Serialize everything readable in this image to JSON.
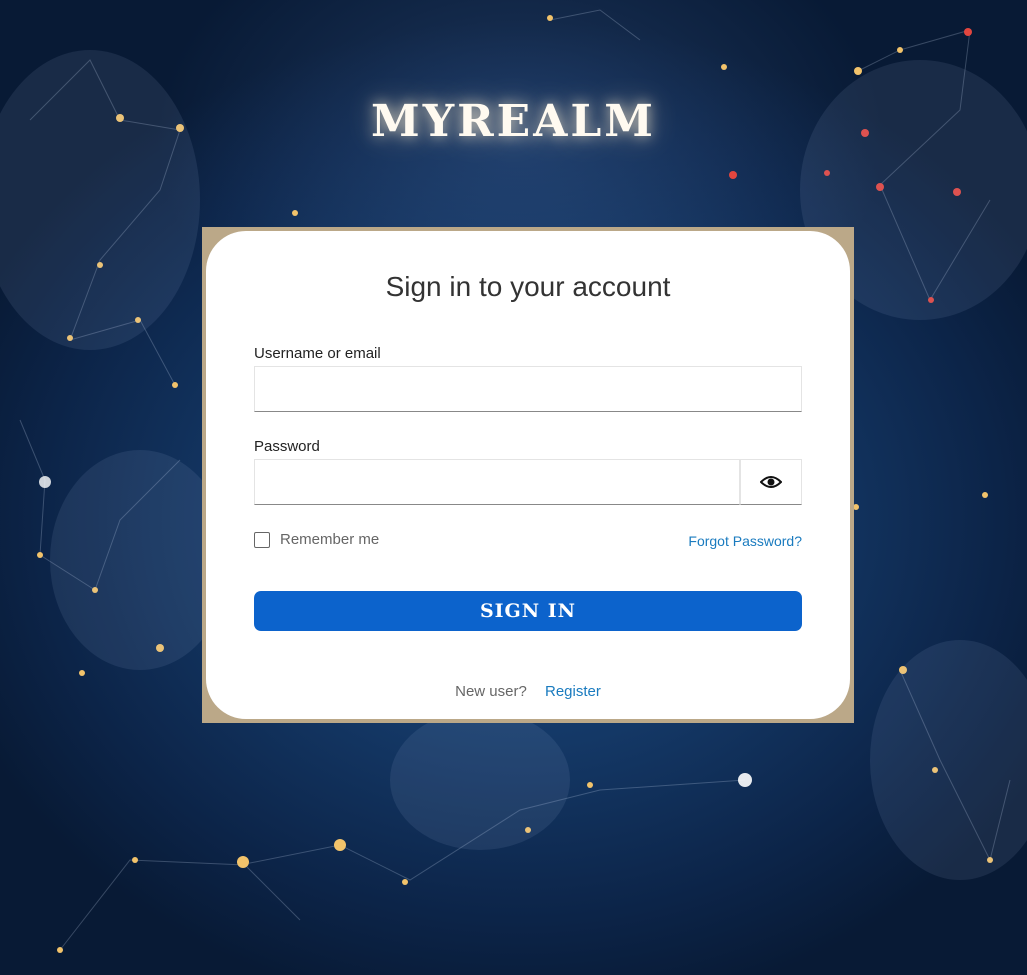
{
  "brand": {
    "logo_text": "MYREALM"
  },
  "login": {
    "title": "Sign in to your account",
    "username_label": "Username or email",
    "username_value": "",
    "password_label": "Password",
    "password_value": "",
    "remember_label": "Remember me",
    "remember_checked": false,
    "forgot_label": "Forgot Password?",
    "signin_label": "SIGN IN",
    "new_user_label": "New user?",
    "register_label": "Register"
  },
  "icons": {
    "password_toggle": "eye-icon"
  },
  "colors": {
    "background": "#143866",
    "card_border": "#bba888",
    "primary_button": "#0c63cc",
    "link": "#1a7bbf"
  }
}
